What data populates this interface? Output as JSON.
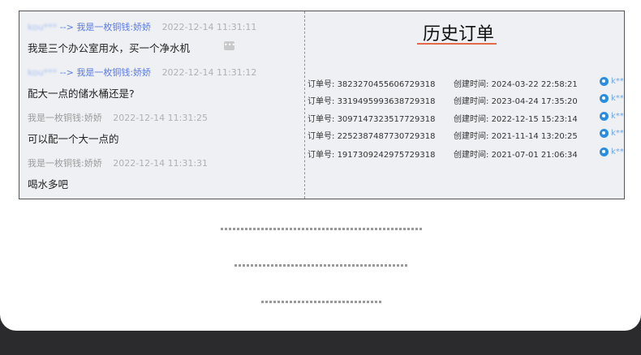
{
  "chat": {
    "messages": [
      {
        "from": "kou***",
        "arrow": "-->",
        "to": "我是一枚铜钱:娇娇",
        "time": "2022-12-14 11:31:11",
        "text": "我是三个办公室用水，买一个净水机"
      },
      {
        "from": "kou***",
        "arrow": "-->",
        "to": "我是一枚铜钱:娇娇",
        "time": "2022-12-14 11:31:12",
        "text": "配大一点的储水桶还是?"
      },
      {
        "from": "我是一枚铜钱:娇娇",
        "time": "2022-12-14 11:31:25",
        "text": "可以配一个大一点的"
      },
      {
        "from": "我是一枚铜钱:娇娇",
        "time": "2022-12-14 11:31:31",
        "text": "喝水多吧"
      }
    ],
    "more_icon": "ellipsis-icon"
  },
  "orders": {
    "title": "历史订单",
    "order_label": "订单号:",
    "time_label": "创建时间:",
    "rows": [
      {
        "id": "3823270455606729318",
        "time": "2024-03-22 22:58:21",
        "user": "k**"
      },
      {
        "id": "3319495993638729318",
        "time": "2023-04-24 17:35:20",
        "user": "k**"
      },
      {
        "id": "3097147323517729318",
        "time": "2022-12-15 15:23:14",
        "user": "k**"
      },
      {
        "id": "2252387487730729318",
        "time": "2021-11-14 13:20:25",
        "user": "k**"
      },
      {
        "id": "1917309242975729318",
        "time": "2021-07-01 21:06:34",
        "user": "k**"
      }
    ],
    "accent": "#e06a4a",
    "user_icon": "drop-icon"
  }
}
